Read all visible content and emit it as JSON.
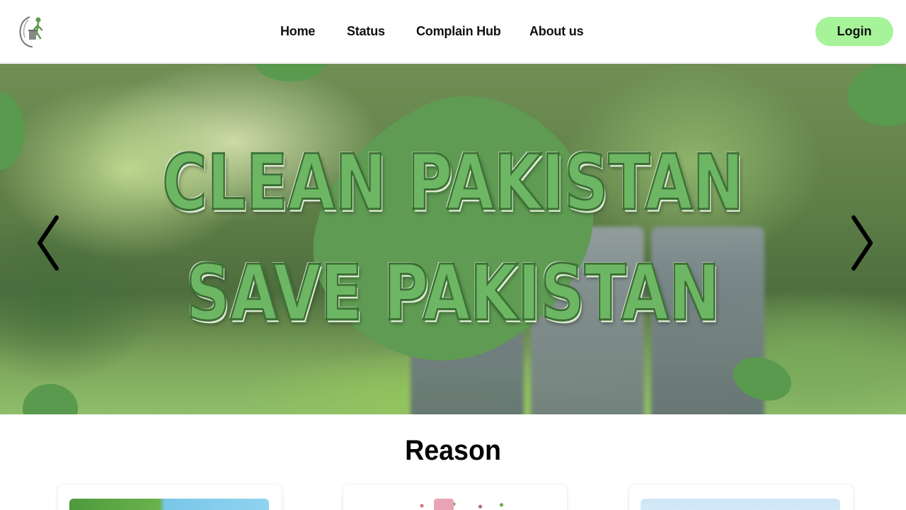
{
  "brand": {
    "logo_icon": "recycle-bin-person-icon"
  },
  "nav": {
    "items": [
      {
        "label": "Home"
      },
      {
        "label": "Status"
      },
      {
        "label": "Complain Hub"
      },
      {
        "label": "About us"
      }
    ],
    "login_label": "Login"
  },
  "hero": {
    "line1": "CLEAN PAKISTAN",
    "line2": "SAVE PAKISTAN",
    "prev_icon": "chevron-left-icon",
    "next_icon": "chevron-right-icon"
  },
  "reason": {
    "title": "Reason"
  },
  "colors": {
    "accent_green": "#5c9a4f",
    "login_bg": "#a6f39a",
    "hero_text": "#6db764"
  }
}
